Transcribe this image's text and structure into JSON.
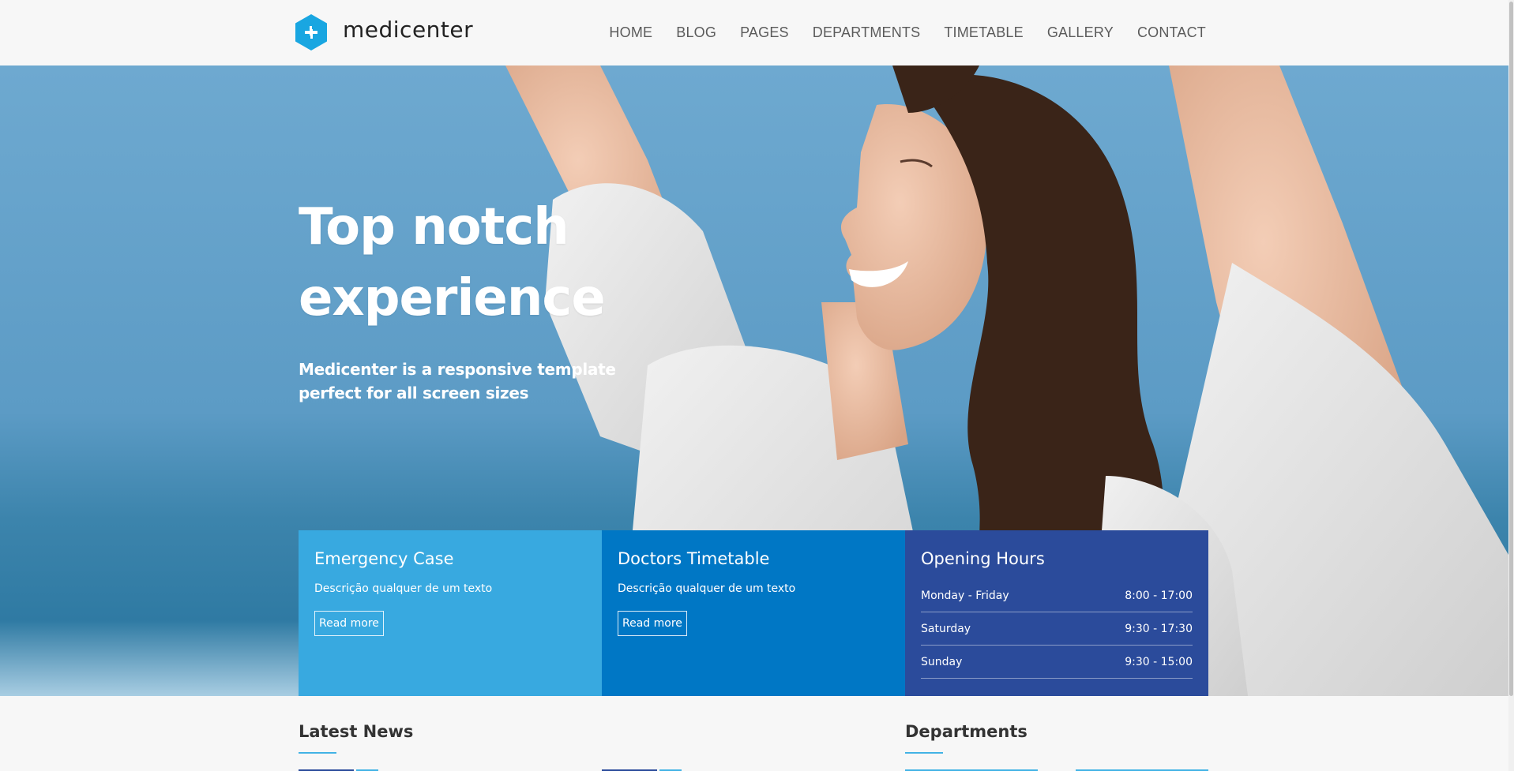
{
  "brand": {
    "name": "medicenter",
    "color": "#19a6e1"
  },
  "nav": {
    "items": [
      "HOME",
      "BLOG",
      "PAGES",
      "DEPARTMENTS",
      "TIMETABLE",
      "GALLERY",
      "CONTACT"
    ]
  },
  "hero": {
    "title": "Top notch experience",
    "subtitle": "Medicenter is a responsive template perfect for all screen sizes"
  },
  "boxes": {
    "emergency": {
      "title": "Emergency Case",
      "text": "Descrição qualquer de um texto",
      "button": "Read more",
      "color": "#38a9e0"
    },
    "timetable": {
      "title": "Doctors Timetable",
      "text": "Descrição qualquer de um texto",
      "button": "Read more",
      "color": "#0077c5"
    },
    "hours": {
      "title": "Opening Hours",
      "color": "#2b4b9b",
      "rows": [
        {
          "day": "Monday - Friday",
          "time": "8:00 - 17:00"
        },
        {
          "day": "Saturday",
          "time": "9:30 - 17:30"
        },
        {
          "day": "Sunday",
          "time": "9:30 - 15:00"
        }
      ]
    }
  },
  "sections": {
    "news": "Latest News",
    "departments": "Departments"
  }
}
